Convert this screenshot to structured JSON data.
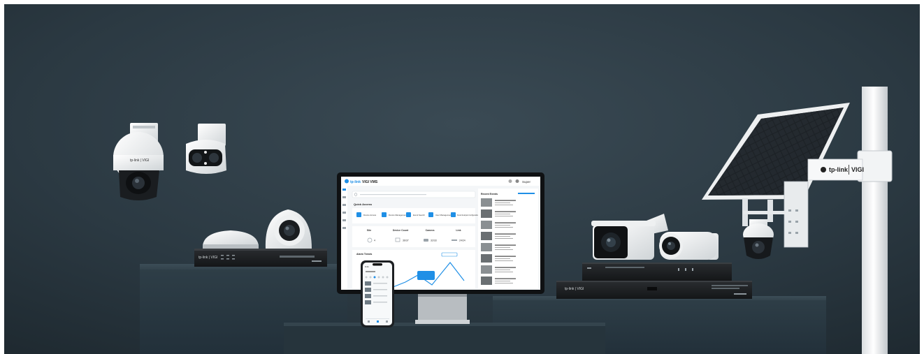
{
  "scene": {
    "background_color": "#2b3a42",
    "accent_color": "#1f8fe6"
  },
  "branding": {
    "bracket_logo": "tp-link",
    "bracket_product": "VIGI",
    "nvr_logo": "tp-link | VIGI",
    "camera_logo": "tp-link | VIGI"
  },
  "monitor": {
    "app_logo": "tp-link",
    "app_name": "VIGI VMS",
    "user_menu": "Super",
    "search_placeholder": "",
    "sections": {
      "quick_access": "Quick Access",
      "alarm_trends": "Alarm Trends",
      "recent_events": "Recent Events"
    },
    "quick_buttons": [
      "Device Access",
      "Device Management",
      "Event Search",
      "User Management",
      "Smart Analysis Configuration"
    ],
    "stats": [
      {
        "label": "Site",
        "value": "4"
      },
      {
        "label": "Device Count",
        "value": "36/37"
      },
      {
        "label": "Camera",
        "value": "32/33"
      },
      {
        "label": "Link",
        "value": "24/24"
      }
    ],
    "chart_tooltip": "",
    "event_count": 8
  },
  "phone": {
    "time": "9:41"
  }
}
